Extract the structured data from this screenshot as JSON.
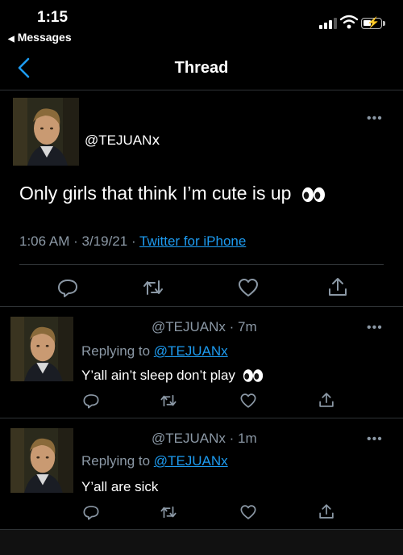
{
  "status_bar": {
    "time": "1:15",
    "back_app": "Messages"
  },
  "nav": {
    "title": "Thread"
  },
  "main_tweet": {
    "handle": "@TEJUAN𝗑",
    "text": "Only girls that think I’m cute is up",
    "time": "1:06 AM",
    "date": "3/19/21",
    "source": "Twitter for iPhone"
  },
  "replies": [
    {
      "handle": "@TEJUANx",
      "age": "7m",
      "replying_prefix": "Replying to",
      "replying_to": "@TEJUANx",
      "text": "Y’all ain’t sleep don’t play"
    },
    {
      "handle": "@TEJUANx",
      "age": "1m",
      "replying_prefix": "Replying to",
      "replying_to": "@TEJUANx",
      "text": "Y’all are sick"
    }
  ],
  "icons": [
    "chevron-left-icon",
    "more-icon",
    "reply-icon",
    "retweet-icon",
    "like-icon",
    "share-icon",
    "eyes-emoji"
  ],
  "colors": {
    "link": "#1d9bf0",
    "muted": "#8b98a5",
    "background": "#000000"
  }
}
